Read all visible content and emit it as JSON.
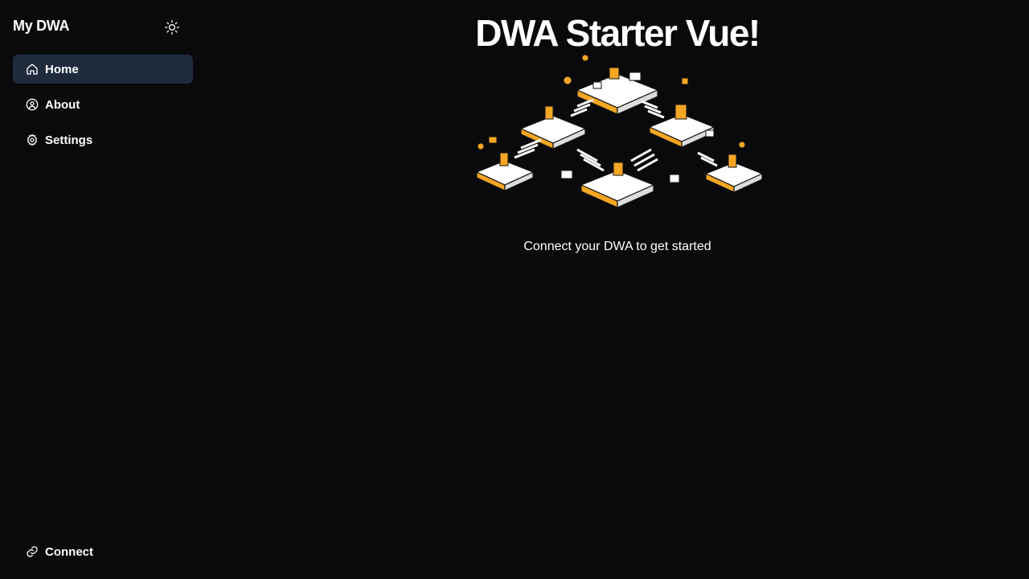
{
  "sidebar": {
    "brand": "My DWA",
    "theme_icon": "sun-icon",
    "items": [
      {
        "label": "Home",
        "icon": "home-icon",
        "active": true
      },
      {
        "label": "About",
        "icon": "user-circle-icon",
        "active": false
      },
      {
        "label": "Settings",
        "icon": "gear-icon",
        "active": false
      }
    ],
    "connect": {
      "label": "Connect",
      "icon": "link-icon"
    }
  },
  "main": {
    "title": "DWA Starter Vue!",
    "subtitle": "Connect your DWA to get started",
    "illustration": "isometric-office-illustration"
  },
  "colors": {
    "background": "#0a0a0c",
    "active_nav": "#1f2a3d",
    "accent": "#f5a623",
    "text": "#ffffff"
  }
}
